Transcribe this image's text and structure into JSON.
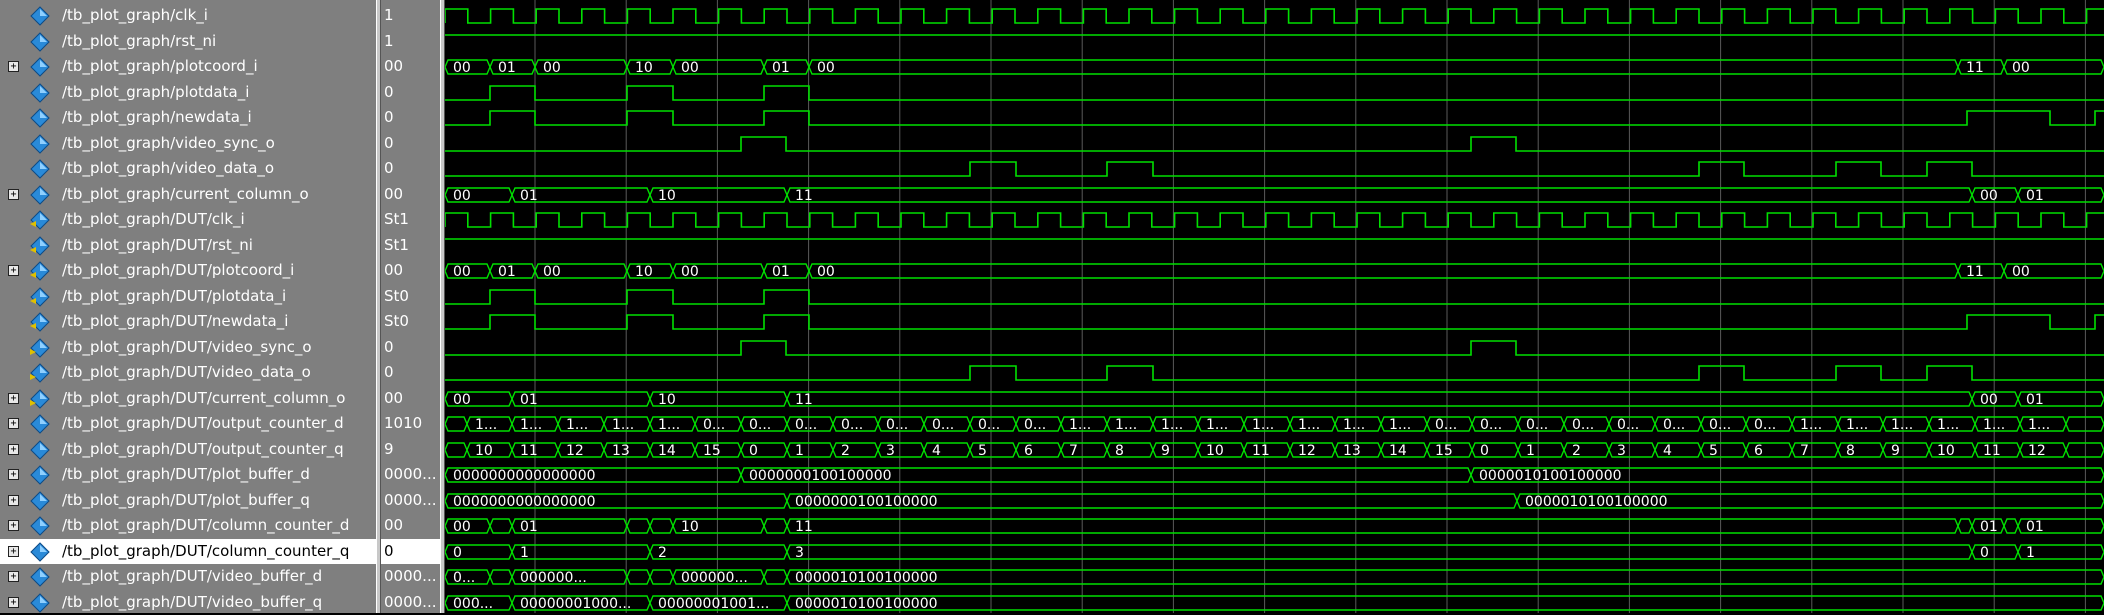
{
  "signals": [
    {
      "name": "/tb_plot_graph/clk_i",
      "value": "1",
      "expand": false,
      "kind": "tb"
    },
    {
      "name": "/tb_plot_graph/rst_ni",
      "value": "1",
      "expand": false,
      "kind": "tb"
    },
    {
      "name": "/tb_plot_graph/plotcoord_i",
      "value": "00",
      "expand": true,
      "kind": "tb"
    },
    {
      "name": "/tb_plot_graph/plotdata_i",
      "value": "0",
      "expand": false,
      "kind": "tb"
    },
    {
      "name": "/tb_plot_graph/newdata_i",
      "value": "0",
      "expand": false,
      "kind": "tb"
    },
    {
      "name": "/tb_plot_graph/video_sync_o",
      "value": "0",
      "expand": false,
      "kind": "tb"
    },
    {
      "name": "/tb_plot_graph/video_data_o",
      "value": "0",
      "expand": false,
      "kind": "tb"
    },
    {
      "name": "/tb_plot_graph/current_column_o",
      "value": "00",
      "expand": true,
      "kind": "tb"
    },
    {
      "name": "/tb_plot_graph/DUT/clk_i",
      "value": "St1",
      "expand": false,
      "kind": "in"
    },
    {
      "name": "/tb_plot_graph/DUT/rst_ni",
      "value": "St1",
      "expand": false,
      "kind": "in"
    },
    {
      "name": "/tb_plot_graph/DUT/plotcoord_i",
      "value": "00",
      "expand": true,
      "kind": "in"
    },
    {
      "name": "/tb_plot_graph/DUT/plotdata_i",
      "value": "St0",
      "expand": false,
      "kind": "in"
    },
    {
      "name": "/tb_plot_graph/DUT/newdata_i",
      "value": "St0",
      "expand": false,
      "kind": "in"
    },
    {
      "name": "/tb_plot_graph/DUT/video_sync_o",
      "value": "0",
      "expand": false,
      "kind": "out"
    },
    {
      "name": "/tb_plot_graph/DUT/video_data_o",
      "value": "0",
      "expand": false,
      "kind": "out"
    },
    {
      "name": "/tb_plot_graph/DUT/current_column_o",
      "value": "00",
      "expand": true,
      "kind": "out"
    },
    {
      "name": "/tb_plot_graph/DUT/output_counter_d",
      "value": "1010",
      "expand": true,
      "kind": "int"
    },
    {
      "name": "/tb_plot_graph/DUT/output_counter_q",
      "value": "9",
      "expand": true,
      "kind": "int"
    },
    {
      "name": "/tb_plot_graph/DUT/plot_buffer_d",
      "value": "0000...",
      "expand": true,
      "kind": "int"
    },
    {
      "name": "/tb_plot_graph/DUT/plot_buffer_q",
      "value": "0000...",
      "expand": true,
      "kind": "int"
    },
    {
      "name": "/tb_plot_graph/DUT/column_counter_d",
      "value": "00",
      "expand": true,
      "kind": "int"
    },
    {
      "name": "/tb_plot_graph/DUT/column_counter_q",
      "value": "0",
      "expand": true,
      "kind": "int",
      "selected": true
    },
    {
      "name": "/tb_plot_graph/DUT/video_buffer_d",
      "value": "0000...",
      "expand": true,
      "kind": "int"
    },
    {
      "name": "/tb_plot_graph/DUT/video_buffer_q",
      "value": "0000...",
      "expand": true,
      "kind": "int"
    }
  ],
  "waves": [
    {
      "type": "clock"
    },
    {
      "type": "const",
      "level": 1
    },
    {
      "type": "bus",
      "segments": [
        {
          "t": 0,
          "label": "00"
        },
        {
          "t": 45,
          "label": "01"
        },
        {
          "t": 90,
          "label": "00"
        },
        {
          "t": 182,
          "label": "10"
        },
        {
          "t": 228,
          "label": "00"
        },
        {
          "t": 319,
          "label": "01"
        },
        {
          "t": 364,
          "label": "00"
        },
        {
          "t": 1513,
          "label": "11"
        },
        {
          "t": 1559,
          "label": "00"
        }
      ]
    },
    {
      "type": "bit",
      "edges": [
        [
          0,
          0
        ],
        [
          45,
          1
        ],
        [
          90,
          0
        ],
        [
          182,
          1
        ],
        [
          228,
          0
        ],
        [
          319,
          1
        ],
        [
          364,
          0
        ]
      ]
    },
    {
      "type": "bit",
      "edges": [
        [
          0,
          0
        ],
        [
          45,
          1
        ],
        [
          90,
          0
        ],
        [
          182,
          1
        ],
        [
          228,
          0
        ],
        [
          319,
          1
        ],
        [
          364,
          0
        ],
        [
          1522,
          1
        ],
        [
          1605,
          0
        ],
        [
          1650,
          1
        ]
      ]
    },
    {
      "type": "bit",
      "edges": [
        [
          0,
          0
        ],
        [
          296,
          1
        ],
        [
          341,
          0
        ],
        [
          1026,
          1
        ],
        [
          1071,
          0
        ]
      ]
    },
    {
      "type": "bit",
      "edges": [
        [
          0,
          0
        ],
        [
          525,
          1
        ],
        [
          571,
          0
        ],
        [
          662,
          1
        ],
        [
          708,
          0
        ],
        [
          1254,
          1
        ],
        [
          1299,
          0
        ],
        [
          1391,
          1
        ],
        [
          1436,
          0
        ],
        [
          1482,
          1
        ],
        [
          1527,
          0
        ]
      ]
    },
    {
      "type": "bus",
      "segments": [
        {
          "t": 0,
          "label": "00"
        },
        {
          "t": 67,
          "label": "01"
        },
        {
          "t": 205,
          "label": "10"
        },
        {
          "t": 342,
          "label": "11"
        },
        {
          "t": 1527,
          "label": "00"
        },
        {
          "t": 1573,
          "label": "01"
        }
      ]
    },
    {
      "type": "clock"
    },
    {
      "type": "const",
      "level": 1
    },
    {
      "type": "bus",
      "segments": [
        {
          "t": 0,
          "label": "00"
        },
        {
          "t": 45,
          "label": "01"
        },
        {
          "t": 90,
          "label": "00"
        },
        {
          "t": 182,
          "label": "10"
        },
        {
          "t": 228,
          "label": "00"
        },
        {
          "t": 319,
          "label": "01"
        },
        {
          "t": 364,
          "label": "00"
        },
        {
          "t": 1513,
          "label": "11"
        },
        {
          "t": 1559,
          "label": "00"
        }
      ]
    },
    {
      "type": "bit",
      "edges": [
        [
          0,
          0
        ],
        [
          45,
          1
        ],
        [
          90,
          0
        ],
        [
          182,
          1
        ],
        [
          228,
          0
        ],
        [
          319,
          1
        ],
        [
          364,
          0
        ]
      ]
    },
    {
      "type": "bit",
      "edges": [
        [
          0,
          0
        ],
        [
          45,
          1
        ],
        [
          90,
          0
        ],
        [
          182,
          1
        ],
        [
          228,
          0
        ],
        [
          319,
          1
        ],
        [
          364,
          0
        ],
        [
          1522,
          1
        ],
        [
          1605,
          0
        ],
        [
          1650,
          1
        ]
      ]
    },
    {
      "type": "bit",
      "edges": [
        [
          0,
          0
        ],
        [
          296,
          1
        ],
        [
          341,
          0
        ],
        [
          1026,
          1
        ],
        [
          1071,
          0
        ]
      ]
    },
    {
      "type": "bit",
      "edges": [
        [
          0,
          0
        ],
        [
          525,
          1
        ],
        [
          571,
          0
        ],
        [
          662,
          1
        ],
        [
          708,
          0
        ],
        [
          1254,
          1
        ],
        [
          1299,
          0
        ],
        [
          1391,
          1
        ],
        [
          1436,
          0
        ],
        [
          1482,
          1
        ],
        [
          1527,
          0
        ]
      ]
    },
    {
      "type": "bus",
      "segments": [
        {
          "t": 0,
          "label": "00"
        },
        {
          "t": 67,
          "label": "01"
        },
        {
          "t": 205,
          "label": "10"
        },
        {
          "t": 342,
          "label": "11"
        },
        {
          "t": 1527,
          "label": "00"
        },
        {
          "t": 1573,
          "label": "01"
        }
      ]
    },
    {
      "type": "bus",
      "segments": [
        {
          "t": 0,
          "label": ""
        },
        {
          "t": 22,
          "label": "1..."
        },
        {
          "t": 67,
          "label": "1..."
        },
        {
          "t": 113,
          "label": "1..."
        },
        {
          "t": 159,
          "label": "1..."
        },
        {
          "t": 205,
          "label": "1..."
        },
        {
          "t": 250,
          "label": "0..."
        },
        {
          "t": 296,
          "label": "0..."
        },
        {
          "t": 342,
          "label": "0..."
        },
        {
          "t": 388,
          "label": "0..."
        },
        {
          "t": 433,
          "label": "0..."
        },
        {
          "t": 479,
          "label": "0..."
        },
        {
          "t": 525,
          "label": "0..."
        },
        {
          "t": 571,
          "label": "0..."
        },
        {
          "t": 616,
          "label": "1..."
        },
        {
          "t": 662,
          "label": "1..."
        },
        {
          "t": 708,
          "label": "1..."
        },
        {
          "t": 753,
          "label": "1..."
        },
        {
          "t": 799,
          "label": "1..."
        },
        {
          "t": 845,
          "label": "1..."
        },
        {
          "t": 890,
          "label": "1..."
        },
        {
          "t": 936,
          "label": "1..."
        },
        {
          "t": 982,
          "label": "0..."
        },
        {
          "t": 1027,
          "label": "0..."
        },
        {
          "t": 1073,
          "label": "0..."
        },
        {
          "t": 1119,
          "label": "0..."
        },
        {
          "t": 1164,
          "label": "0..."
        },
        {
          "t": 1210,
          "label": "0..."
        },
        {
          "t": 1256,
          "label": "0..."
        },
        {
          "t": 1301,
          "label": "0..."
        },
        {
          "t": 1347,
          "label": "1..."
        },
        {
          "t": 1393,
          "label": "1..."
        },
        {
          "t": 1438,
          "label": "1..."
        },
        {
          "t": 1484,
          "label": "1..."
        },
        {
          "t": 1530,
          "label": "1..."
        },
        {
          "t": 1575,
          "label": "1..."
        },
        {
          "t": 1621,
          "label": ""
        }
      ]
    },
    {
      "type": "bus",
      "segments": [
        {
          "t": 0,
          "label": ""
        },
        {
          "t": 22,
          "label": "10"
        },
        {
          "t": 67,
          "label": "11"
        },
        {
          "t": 113,
          "label": "12"
        },
        {
          "t": 159,
          "label": "13"
        },
        {
          "t": 205,
          "label": "14"
        },
        {
          "t": 250,
          "label": "15"
        },
        {
          "t": 296,
          "label": "0"
        },
        {
          "t": 342,
          "label": "1"
        },
        {
          "t": 388,
          "label": "2"
        },
        {
          "t": 433,
          "label": "3"
        },
        {
          "t": 479,
          "label": "4"
        },
        {
          "t": 525,
          "label": "5"
        },
        {
          "t": 571,
          "label": "6"
        },
        {
          "t": 616,
          "label": "7"
        },
        {
          "t": 662,
          "label": "8"
        },
        {
          "t": 708,
          "label": "9"
        },
        {
          "t": 753,
          "label": "10"
        },
        {
          "t": 799,
          "label": "11"
        },
        {
          "t": 845,
          "label": "12"
        },
        {
          "t": 890,
          "label": "13"
        },
        {
          "t": 936,
          "label": "14"
        },
        {
          "t": 982,
          "label": "15"
        },
        {
          "t": 1027,
          "label": "0"
        },
        {
          "t": 1073,
          "label": "1"
        },
        {
          "t": 1119,
          "label": "2"
        },
        {
          "t": 1164,
          "label": "3"
        },
        {
          "t": 1210,
          "label": "4"
        },
        {
          "t": 1256,
          "label": "5"
        },
        {
          "t": 1301,
          "label": "6"
        },
        {
          "t": 1347,
          "label": "7"
        },
        {
          "t": 1393,
          "label": "8"
        },
        {
          "t": 1438,
          "label": "9"
        },
        {
          "t": 1484,
          "label": "10"
        },
        {
          "t": 1530,
          "label": "11"
        },
        {
          "t": 1575,
          "label": "12"
        },
        {
          "t": 1621,
          "label": ""
        }
      ]
    },
    {
      "type": "bus",
      "segments": [
        {
          "t": 0,
          "label": "0000000000000000"
        },
        {
          "t": 296,
          "label": "0000000100100000"
        },
        {
          "t": 1026,
          "label": "0000010100100000"
        }
      ]
    },
    {
      "type": "bus",
      "segments": [
        {
          "t": 0,
          "label": "0000000000000000"
        },
        {
          "t": 342,
          "label": "0000000100100000"
        },
        {
          "t": 1072,
          "label": "0000010100100000"
        }
      ]
    },
    {
      "type": "bus",
      "segments": [
        {
          "t": 0,
          "label": "00"
        },
        {
          "t": 45,
          "label": ""
        },
        {
          "t": 67,
          "label": "01"
        },
        {
          "t": 182,
          "label": ""
        },
        {
          "t": 205,
          "label": ""
        },
        {
          "t": 228,
          "label": "10"
        },
        {
          "t": 319,
          "label": ""
        },
        {
          "t": 342,
          "label": "11"
        },
        {
          "t": 1513,
          "label": ""
        },
        {
          "t": 1527,
          "label": "01"
        },
        {
          "t": 1559,
          "label": ""
        },
        {
          "t": 1573,
          "label": "01"
        }
      ]
    },
    {
      "type": "bus",
      "segments": [
        {
          "t": 0,
          "label": "0"
        },
        {
          "t": 67,
          "label": "1"
        },
        {
          "t": 205,
          "label": "2"
        },
        {
          "t": 342,
          "label": "3"
        },
        {
          "t": 1527,
          "label": "0"
        },
        {
          "t": 1573,
          "label": "1"
        }
      ]
    },
    {
      "type": "bus",
      "segments": [
        {
          "t": 0,
          "label": "0..."
        },
        {
          "t": 45,
          "label": ""
        },
        {
          "t": 67,
          "label": "000000..."
        },
        {
          "t": 182,
          "label": ""
        },
        {
          "t": 205,
          "label": ""
        },
        {
          "t": 228,
          "label": "000000..."
        },
        {
          "t": 319,
          "label": ""
        },
        {
          "t": 342,
          "label": "0000010100100000"
        }
      ]
    },
    {
      "type": "bus",
      "segments": [
        {
          "t": 0,
          "label": "000..."
        },
        {
          "t": 67,
          "label": "00000001000..."
        },
        {
          "t": 205,
          "label": "00000001001..."
        },
        {
          "t": 342,
          "label": "0000010100100000"
        }
      ]
    }
  ],
  "clock_period": 45.6,
  "clock_offset": 0,
  "colors": {
    "wave": "#00e000",
    "grid": "#5a5a5a",
    "text": "#ffffff",
    "tb_icon": "#2a8ad8",
    "in_icon": "#2a8ad8",
    "out_icon": "#2a8ad8",
    "arrow": "#e0c000"
  }
}
